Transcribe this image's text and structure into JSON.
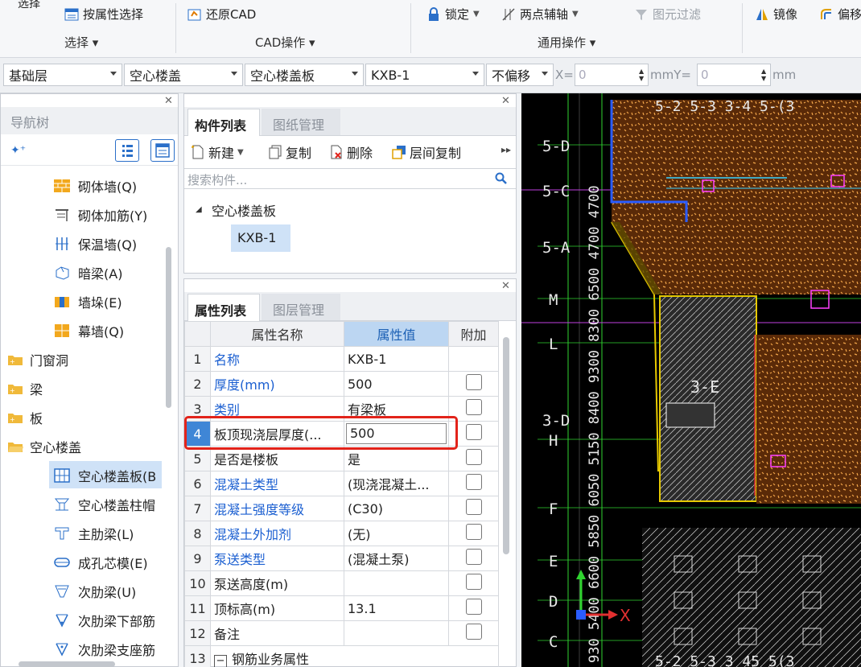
{
  "ribbon": {
    "items": {
      "select_top": "选择",
      "select_by_attr": "按属性选择",
      "restore_cad": "还原CAD",
      "lock": "锁定",
      "two_point_axis": "两点辅轴",
      "element_filter": "图元过滤",
      "mirror": "镜像",
      "offset": "偏移"
    },
    "groups": {
      "select": "选择 ▾",
      "cad_ops": "CAD操作 ▾",
      "common_ops": "通用操作 ▾"
    }
  },
  "selectors": {
    "floor": "基础层",
    "category": "空心楼盖",
    "type": "空心楼盖板",
    "component": "KXB-1",
    "offset_mode": "不偏移",
    "x_label": "X=",
    "x_value": "0",
    "mm_y_label": "mmY=",
    "y_value": "0",
    "mm_label": "mm"
  },
  "nav": {
    "title": "导航树",
    "items": [
      {
        "label": "砌体墙(Q)"
      },
      {
        "label": "砌体加筋(Y)"
      },
      {
        "label": "保温墙(Q)"
      },
      {
        "label": "暗梁(A)"
      },
      {
        "label": "墙垛(E)"
      },
      {
        "label": "幕墙(Q)"
      }
    ],
    "folders": [
      {
        "label": "门窗洞"
      },
      {
        "label": "梁"
      },
      {
        "label": "板"
      },
      {
        "label": "空心楼盖"
      }
    ],
    "sub_items": [
      {
        "label": "空心楼盖板(B"
      },
      {
        "label": "空心楼盖柱帽"
      },
      {
        "label": "主肋梁(L)"
      },
      {
        "label": "成孔芯模(E)"
      },
      {
        "label": "次肋梁(U)"
      },
      {
        "label": "次肋梁下部筋"
      },
      {
        "label": "次肋梁支座筋"
      }
    ]
  },
  "component_panel": {
    "tab_active": "构件列表",
    "tab_inactive": "图纸管理",
    "toolbar": {
      "new": "新建",
      "copy": "复制",
      "delete": "删除",
      "floor_copy": "层间复制"
    },
    "search_placeholder": "搜索构件...",
    "tree_parent": "空心楼盖板",
    "tree_child": "KXB-1"
  },
  "property_panel": {
    "tab_active": "属性列表",
    "tab_inactive": "图层管理",
    "headers": {
      "name": "属性名称",
      "value": "属性值",
      "extra": "附加"
    },
    "rows": [
      {
        "num": "1",
        "name": "名称",
        "value": "KXB-1"
      },
      {
        "num": "2",
        "name": "厚度(mm)",
        "value": "500"
      },
      {
        "num": "3",
        "name": "类别",
        "value": "有梁板"
      },
      {
        "num": "4",
        "name": "板顶现浇层厚度(...",
        "value": "500"
      },
      {
        "num": "5",
        "name": "是否是楼板",
        "value": "是"
      },
      {
        "num": "6",
        "name": "混凝土类型",
        "value": "(现浇混凝土..."
      },
      {
        "num": "7",
        "name": "混凝土强度等级",
        "value": "(C30)"
      },
      {
        "num": "8",
        "name": "混凝土外加剂",
        "value": "(无)"
      },
      {
        "num": "9",
        "name": "泵送类型",
        "value": "(混凝土泵)"
      },
      {
        "num": "10",
        "name": "泵送高度(m)",
        "value": ""
      },
      {
        "num": "11",
        "name": "顶标高(m)",
        "value": "13.1"
      },
      {
        "num": "12",
        "name": "备注",
        "value": ""
      },
      {
        "num": "13",
        "name": "钢筋业务属性",
        "value": ""
      }
    ],
    "collapse_sign": "−"
  },
  "cad": {
    "axis_labels": [
      "5-D",
      "5-C",
      "5-A",
      "M",
      "L",
      "3-D",
      "H",
      "F",
      "E",
      "D",
      "C"
    ],
    "dims": "930 5400 6600 5850 6050 5150 8400 9300 8300 6500 4700 4700",
    "top_labels": "5-2 5-3 3-4 5-(3",
    "bottom_labels": "5-2 5-3 3 45 5(3",
    "x_axis": "X",
    "region_label": "3-E"
  },
  "colors": {
    "accent_blue": "#1b5fd1",
    "header_highlight": "#bcd6f2",
    "selection_red": "#e2231a",
    "cad_bg": "#000000"
  }
}
